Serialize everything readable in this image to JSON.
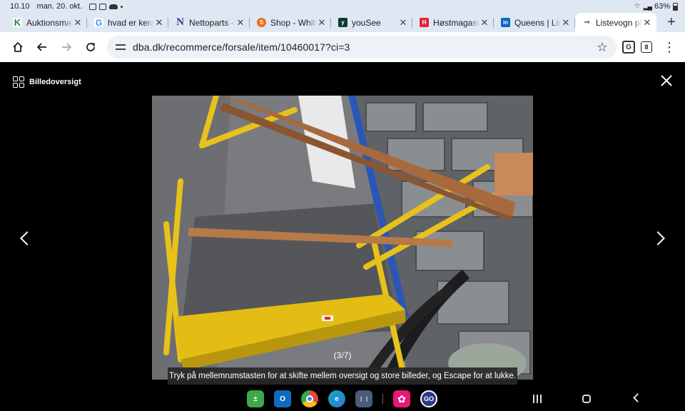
{
  "status": {
    "time": "10.10",
    "date": "man. 20. okt.",
    "battery": "63%"
  },
  "tabs": [
    {
      "title": "Auktionsmægl",
      "favicon": "K",
      "color": "#1a8a3a"
    },
    {
      "title": "hvad er kerat",
      "favicon": "G",
      "color": "#4285f4"
    },
    {
      "title": "Nettoparts - p",
      "favicon": "N",
      "color": "#2b3a8c"
    },
    {
      "title": "Shop - White",
      "favicon": "S",
      "color": "#f06a1f"
    },
    {
      "title": "youSee",
      "favicon": "y",
      "color": "#0b3d2e"
    },
    {
      "title": "Høstmagasin",
      "favicon": "H",
      "color": "#e2253a"
    },
    {
      "title": "Queens | Link",
      "favicon": "in",
      "color": "#0a66c2"
    },
    {
      "title": "Listevogn pla",
      "favicon": "d",
      "color": "#8a8a8a"
    }
  ],
  "toolbar": {
    "url": "dba.dk/recommerce/forsale/item/10460017?ci=3",
    "tab_count": "8"
  },
  "viewer": {
    "overview_label": "Billedoversigt",
    "counter": "(3/7)",
    "hint": "Tryk på mellemrumstasten for at skifte mellem oversigt og store billeder, og Escape for at lukke."
  },
  "dock": [
    {
      "name": "calculator-app-icon",
      "label": "±",
      "color": "#3ea84b"
    },
    {
      "name": "outlook-app-icon",
      "label": "O",
      "color": "#0f6cbd"
    },
    {
      "name": "chrome-app-icon",
      "label": "",
      "color": "#e8453c"
    },
    {
      "name": "edge-app-icon",
      "label": "e",
      "color": "#1ba6b8"
    },
    {
      "name": "app-drawer-icon",
      "label": "⋮⋮",
      "color": "#4a5a7a"
    },
    {
      "name": "blossom-app-icon",
      "label": "✿",
      "color": "#e5197a"
    },
    {
      "name": "go-app-icon",
      "label": "GO",
      "color": "#2a3a8a"
    }
  ]
}
